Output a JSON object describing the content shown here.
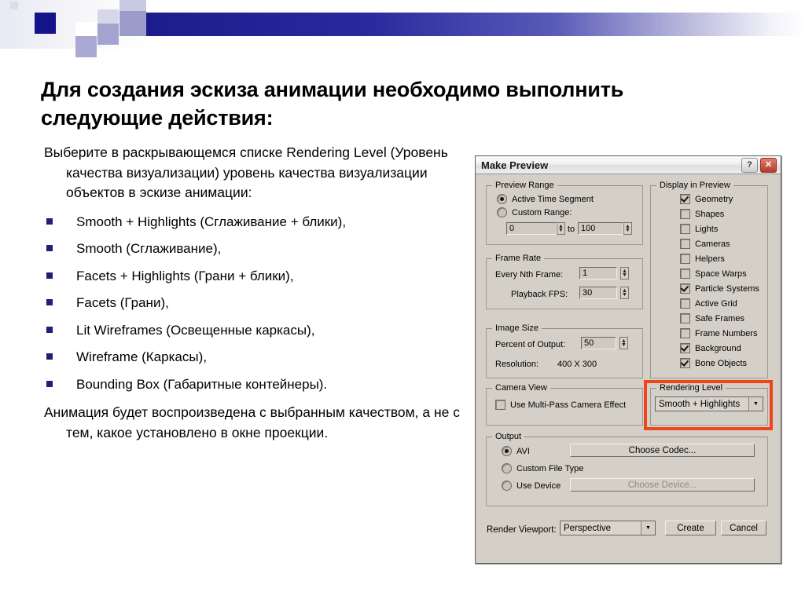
{
  "slide": {
    "title": "Для создания эскиза анимации необходимо выполнить следующие действия:",
    "intro": "Выберите в раскрывающемся списке Rendering Level (Уровень качества визуализации) уровень качества визуализации объектов в эскизе анимации:",
    "bullets": [
      "Smooth + Highlights (Сглаживание + блики),",
      "Smooth (Сглаживание),",
      " Facets + Highlights (Грани + блики),",
      "Facets (Грани),",
      "Lit Wireframes (Освещенные каркасы),",
      "Wireframe (Каркасы),",
      "Bounding Box (Габаритные контейнеры)."
    ],
    "outro": "Анимация будет воспроизведена с выбранным качеством, а не с тем, какое установлено в окне проекции."
  },
  "dialog": {
    "title": "Make Preview",
    "help_button": "?",
    "close_button": "✕",
    "preview_range": {
      "title": "Preview Range",
      "active_time_segment": "Active Time Segment",
      "custom_range": "Custom Range:",
      "from_value": "0",
      "to_label": "to",
      "to_value": "100"
    },
    "frame_rate": {
      "title": "Frame Rate",
      "every_nth_label": "Every Nth Frame:",
      "every_nth_value": "1",
      "playback_fps_label": "Playback FPS:",
      "playback_fps_value": "30"
    },
    "image_size": {
      "title": "Image Size",
      "percent_label": "Percent of Output:",
      "percent_value": "50",
      "resolution_label": "Resolution:",
      "resolution_value": "400  X  300"
    },
    "camera_view": {
      "title": "Camera View",
      "multipass_label": "Use Multi-Pass Camera Effect"
    },
    "output": {
      "title": "Output",
      "avi_label": "AVI",
      "choose_codec_label": "Choose Codec...",
      "custom_file_type_label": "Custom File Type",
      "use_device_label": "Use Device",
      "choose_device_label": "Choose Device..."
    },
    "display_in_preview": {
      "title": "Display in Preview",
      "items": [
        {
          "label": "Geometry",
          "checked": true
        },
        {
          "label": "Shapes",
          "checked": false
        },
        {
          "label": "Lights",
          "checked": false
        },
        {
          "label": "Cameras",
          "checked": false
        },
        {
          "label": "Helpers",
          "checked": false
        },
        {
          "label": "Space Warps",
          "checked": false
        },
        {
          "label": "Particle Systems",
          "checked": true
        },
        {
          "label": "Active Grid",
          "checked": false
        },
        {
          "label": "Safe Frames",
          "checked": false
        },
        {
          "label": "Frame Numbers",
          "checked": false
        },
        {
          "label": "Background",
          "checked": true
        },
        {
          "label": "Bone Objects",
          "checked": true
        }
      ]
    },
    "rendering_level": {
      "title": "Rendering Level",
      "selected": "Smooth + Highlights",
      "highlight_color": "#f0441c"
    },
    "footer": {
      "render_viewport_label": "Render Viewport:",
      "render_viewport_value": "Perspective",
      "create_label": "Create",
      "cancel_label": "Cancel"
    }
  }
}
